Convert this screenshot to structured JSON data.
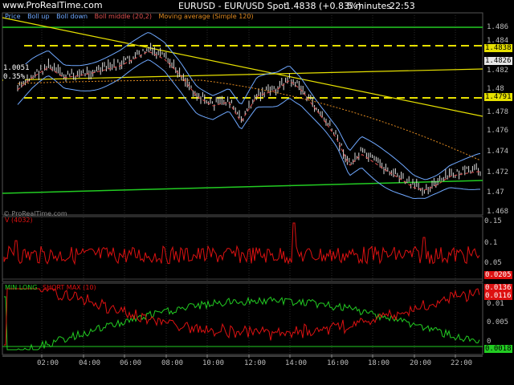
{
  "header": {
    "brand": "www.ProRealTime.com",
    "symbol": "EURUSD - EUR/USD Spot",
    "price_change": "1.4838 (+0.83%)",
    "interval": "5 minutes",
    "clock": "22:53"
  },
  "legend": [
    {
      "label": "Price",
      "color": "#6fa8ff"
    },
    {
      "label": "Boll up",
      "color": "#6fa8ff"
    },
    {
      "label": "Boll down",
      "color": "#6fa8ff"
    },
    {
      "label": "Boll middle (20,2)",
      "color": "#e05050"
    },
    {
      "label": "Moving average (Simple 120)",
      "color": "#e08a20"
    }
  ],
  "watermark": "© ProRealTime.com",
  "left_tags": {
    "a": "1.0051",
    "b": "0.35%"
  },
  "price_axis": {
    "ticks": [
      "1.486",
      "1.484",
      "1.482",
      "1.48",
      "1.478",
      "1.476",
      "1.474",
      "1.472",
      "1.47",
      "1.468"
    ],
    "highlight_tags": [
      "1.4838",
      "1.4826",
      "1.4791"
    ]
  },
  "panel2": {
    "label": "V (4032)",
    "ticks": [
      "0.15",
      "0.1",
      "0.05"
    ],
    "value_tag": "0.0205"
  },
  "panel3": {
    "label_min": "MIN LONG",
    "label_short": "SHORT MAX (10)",
    "ticks": [
      "0.0136",
      "0.0116",
      "0.01",
      "0.005",
      "0"
    ],
    "value_tag": "0.0018"
  },
  "time_axis": [
    "02:00",
    "04:00",
    "06:00",
    "08:00",
    "10:00",
    "12:00",
    "14:00",
    "16:00",
    "18:00",
    "20:00",
    "22:00"
  ],
  "colors": {
    "bg": "#000000",
    "bar": "#dcdcdc",
    "boll": "#6fa8ff",
    "boll_mid": "#e05050",
    "ma": "#e08a20",
    "green": "#22cc22",
    "yellow": "#e6e000",
    "red": "#dd1111"
  }
}
